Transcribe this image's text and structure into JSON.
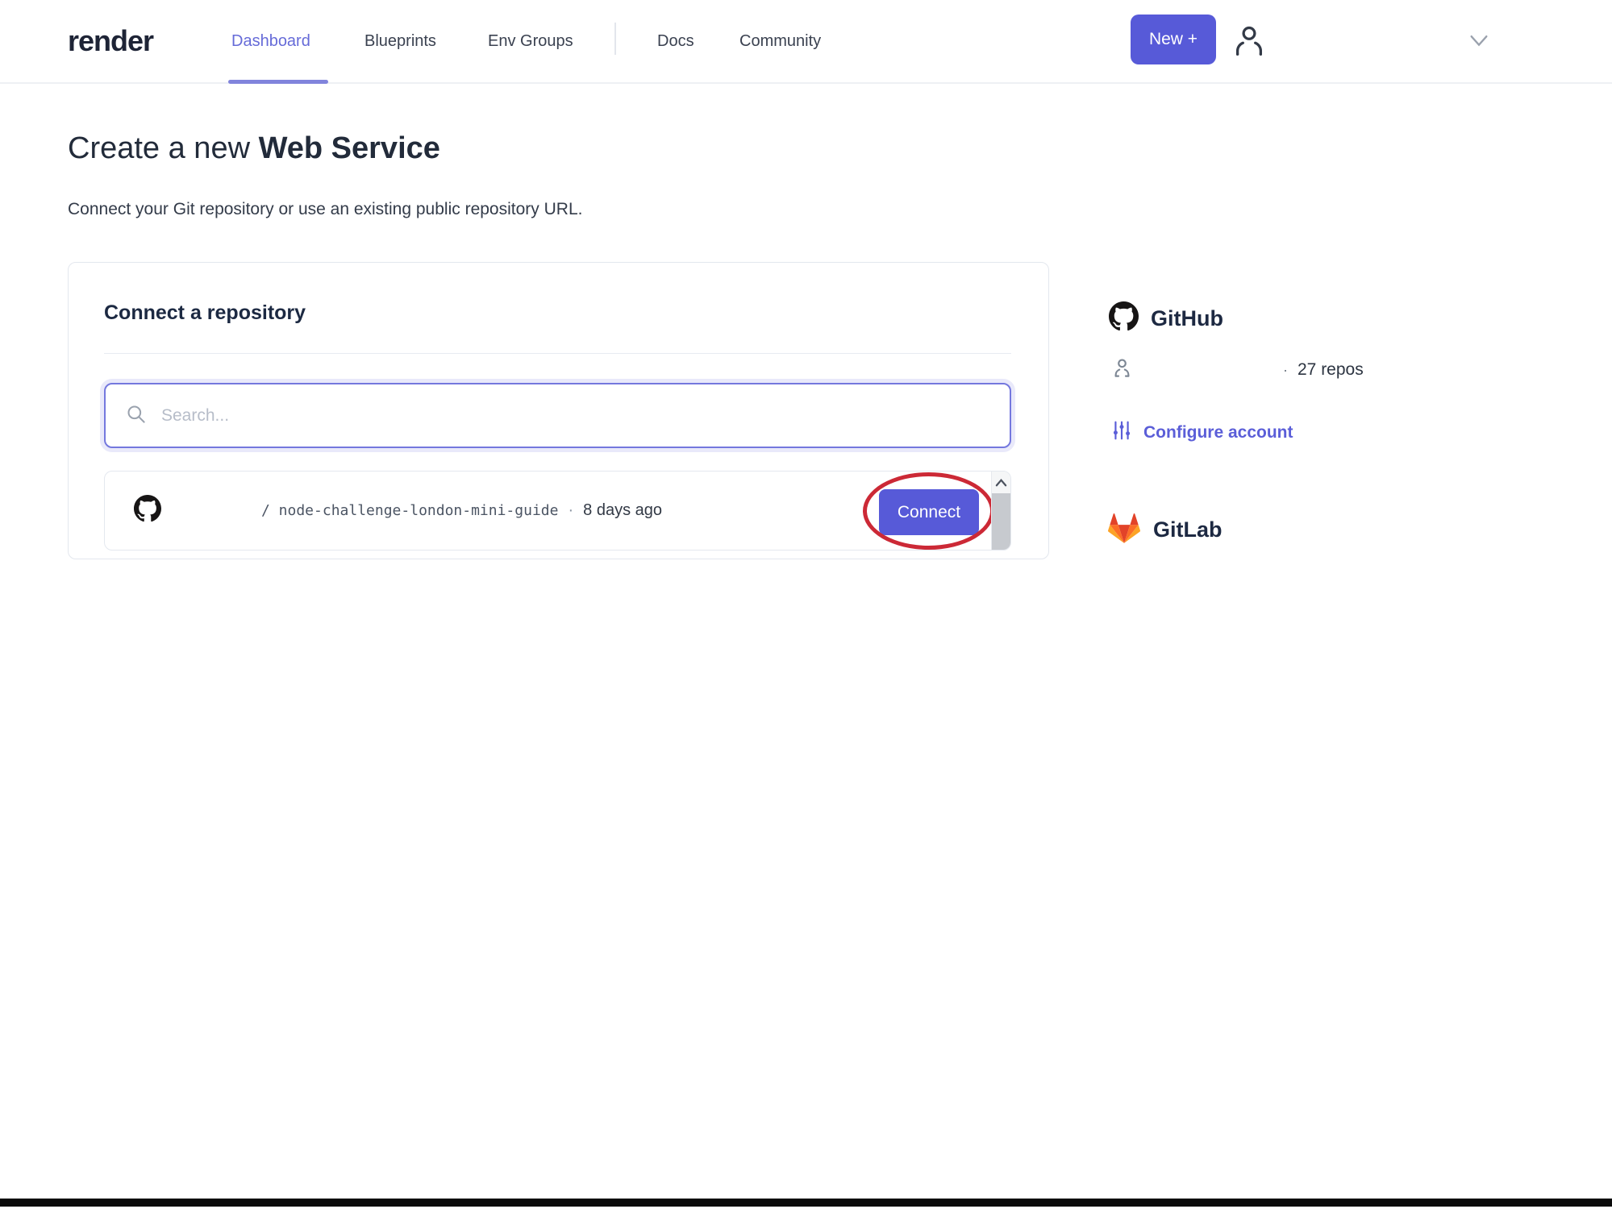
{
  "brand": {
    "logo": "render"
  },
  "nav": {
    "items": [
      {
        "label": "Dashboard",
        "active": true
      },
      {
        "label": "Blueprints",
        "active": false
      },
      {
        "label": "Env Groups",
        "active": false
      },
      {
        "label": "Docs",
        "active": false
      },
      {
        "label": "Community",
        "active": false
      }
    ],
    "new_button_label": "New +"
  },
  "page": {
    "title_regular": "Create a new ",
    "title_bold": "Web Service",
    "subtitle": "Connect your Git repository or use an existing public repository URL."
  },
  "card": {
    "heading": "Connect a repository",
    "search_placeholder": "Search...",
    "repo": {
      "path": "/ node-challenge-london-mini-guide",
      "separator": "·",
      "updated": "8 days ago",
      "connect_label": "Connect"
    }
  },
  "sidebar": {
    "github": {
      "title": "GitHub",
      "repos_separator": "·",
      "repos_count": "27 repos",
      "configure_label": "Configure account"
    },
    "gitlab": {
      "title": "GitLab"
    }
  },
  "colors": {
    "accent": "#575ad8",
    "active_nav": "#666bd8",
    "annotation_red": "#cc2936",
    "github_black": "#171515",
    "gitlab_orange": "#e24329"
  }
}
